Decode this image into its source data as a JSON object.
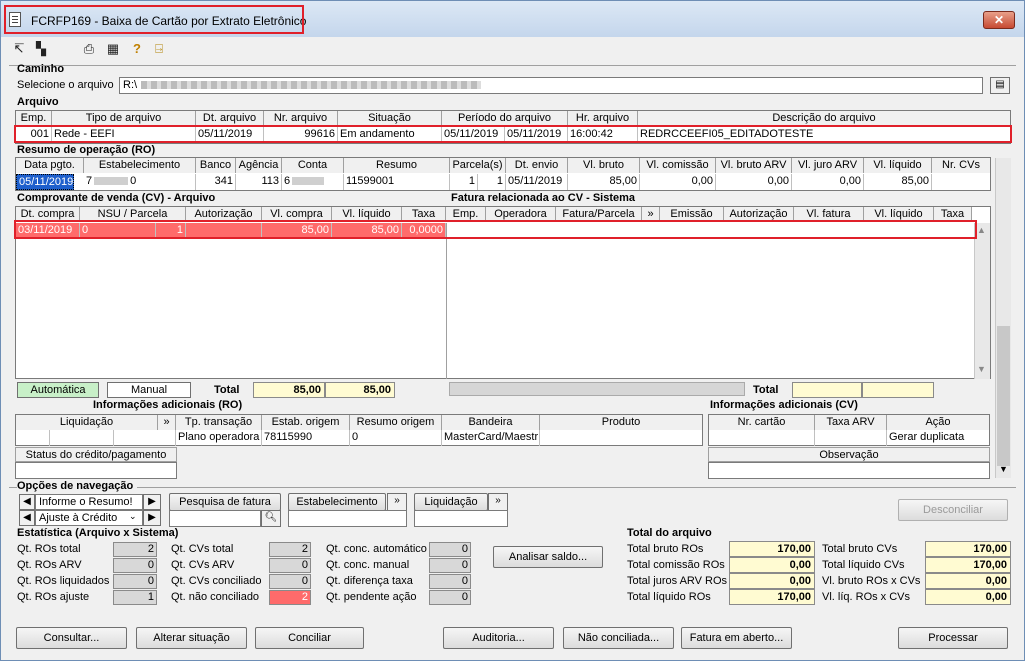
{
  "window": {
    "title": "FCRFP169 - Baixa de Cartão por Extrato Eletrônico",
    "close": "✕"
  },
  "toolbar": {
    "icons": [
      "arrow-icon",
      "select-icon",
      "printer-icon",
      "calculator-icon",
      "help-icon",
      "exit-icon"
    ],
    "glyphs": [
      "↸",
      "▚",
      "⎙",
      "▦",
      "?",
      "⍈"
    ]
  },
  "caminho": {
    "section": "Caminho",
    "label": "Selecione o arquivo",
    "value": "R:\\"
  },
  "arquivo": {
    "section": "Arquivo",
    "headers": [
      "Emp.",
      "Tipo de arquivo",
      "Dt. arquivo",
      "Nr. arquivo",
      "Situação",
      "Período do arquivo",
      "Hr. arquivo",
      "Descrição do arquivo"
    ],
    "row": [
      "001",
      "Rede - EEFI",
      "05/11/2019",
      "99616",
      "Em andamento",
      "05/11/2019",
      "05/11/2019",
      "16:00:42",
      "REDRCCEEFI05_EDITADOTESTE"
    ]
  },
  "ro": {
    "section": "Resumo de operação (RO)",
    "headers": [
      "Data pgto.",
      "Estabelecimento",
      "Banco",
      "Agência",
      "Conta",
      "Resumo",
      "Parcela(s)",
      "Dt. envio",
      "Vl. bruto",
      "Vl. comissão",
      "Vl. bruto ARV",
      "Vl. juro ARV",
      "Vl. líquido",
      "Nr. CVs"
    ],
    "row": [
      "05/11/2019",
      "7",
      "341",
      "113",
      "6",
      "0",
      "11599001",
      "1",
      "1",
      "05/11/2019",
      "85,00",
      "0,00",
      "0,00",
      "0,00",
      "85,00",
      ""
    ]
  },
  "cv": {
    "section": "Comprovante de venda (CV) - Arquivo",
    "headers": [
      "Dt. compra",
      "NSU / Parcela",
      "Autorização",
      "Vl. compra",
      "Vl. líquido",
      "Taxa"
    ],
    "row": [
      "03/11/2019",
      "0",
      "1",
      "",
      "85,00",
      "85,00",
      "0,0000"
    ],
    "mode_auto": "Automática",
    "mode_manual": "Manual",
    "total_label": "Total",
    "total_compra": "85,00",
    "total_liquido": "85,00"
  },
  "fatura": {
    "section": "Fatura relacionada ao CV - Sistema",
    "headers": [
      "Emp.",
      "Operadora",
      "Fatura/Parcela",
      "»",
      "Emissão",
      "Autorização",
      "Vl. fatura",
      "Vl. líquido",
      "Taxa"
    ],
    "total_label": "Total"
  },
  "info_ro": {
    "section": "Informações adicionais (RO)",
    "headers": [
      "Liquidação",
      "»",
      "Tp. transação",
      "Estab. origem",
      "Resumo origem",
      "Bandeira",
      "Produto"
    ],
    "row": [
      "Plano operadora",
      "78115990",
      "0",
      "MasterCard/Maestr",
      ""
    ],
    "status_label": "Status do crédito/pagamento"
  },
  "info_cv": {
    "section": "Informações adicionais (CV)",
    "headers": [
      "Nr. cartão",
      "Taxa ARV",
      "Ação"
    ],
    "row": [
      "",
      "",
      "Gerar duplicata"
    ],
    "obs_label": "Observação"
  },
  "nav": {
    "section": "Opções de navegação",
    "opt1": "Informe o Resumo!",
    "opt2": "Ajuste à Crédito",
    "pesquisa": "Pesquisa de fatura",
    "estab": "Estabelecimento",
    "liquid": "Liquidação",
    "more": "»",
    "desconciliar": "Desconciliar"
  },
  "stats": {
    "section": "Estatística (Arquivo x Sistema)",
    "col1": [
      {
        "label": "Qt. ROs total",
        "value": "2"
      },
      {
        "label": "Qt. ROs ARV",
        "value": "0"
      },
      {
        "label": "Qt. ROs liquidados",
        "value": "0"
      },
      {
        "label": "Qt. ROs ajuste",
        "value": "1"
      }
    ],
    "col2": [
      {
        "label": "Qt. CVs total",
        "value": "2"
      },
      {
        "label": "Qt. CVs ARV",
        "value": "0"
      },
      {
        "label": "Qt. CVs conciliado",
        "value": "0"
      },
      {
        "label": "Qt. não conciliado",
        "value": "2"
      }
    ],
    "col3": [
      {
        "label": "Qt. conc. automático",
        "value": "0"
      },
      {
        "label": "Qt. conc. manual",
        "value": "0"
      },
      {
        "label": "Qt. diferença taxa",
        "value": "0"
      },
      {
        "label": "Qt. pendente ação",
        "value": "0"
      }
    ],
    "analisar": "Analisar saldo..."
  },
  "totals": {
    "section": "Total do arquivo",
    "col1": [
      {
        "label": "Total bruto ROs",
        "value": "170,00"
      },
      {
        "label": "Total comissão ROs",
        "value": "0,00"
      },
      {
        "label": "Total juros ARV ROs",
        "value": "0,00"
      },
      {
        "label": "Total líquido ROs",
        "value": "170,00"
      }
    ],
    "col2": [
      {
        "label": "Total bruto CVs",
        "value": "170,00"
      },
      {
        "label": "Total líquido CVs",
        "value": "170,00"
      },
      {
        "label": "Vl. bruto ROs x CVs",
        "value": "0,00"
      },
      {
        "label": "Vl. líq. ROs x CVs",
        "value": "0,00"
      }
    ]
  },
  "buttons": {
    "consultar": "Consultar...",
    "alterar": "Alterar situação",
    "conciliar": "Conciliar",
    "auditoria": "Auditoria...",
    "nao_conc": "Não conciliada...",
    "fatura_aberto": "Fatura em aberto...",
    "processar": "Processar"
  },
  "colors": {
    "selection": "#ff6b6b",
    "highlight": "#e0202a",
    "auto": "#c8f0c8",
    "total_bg": "#fffbd2"
  }
}
